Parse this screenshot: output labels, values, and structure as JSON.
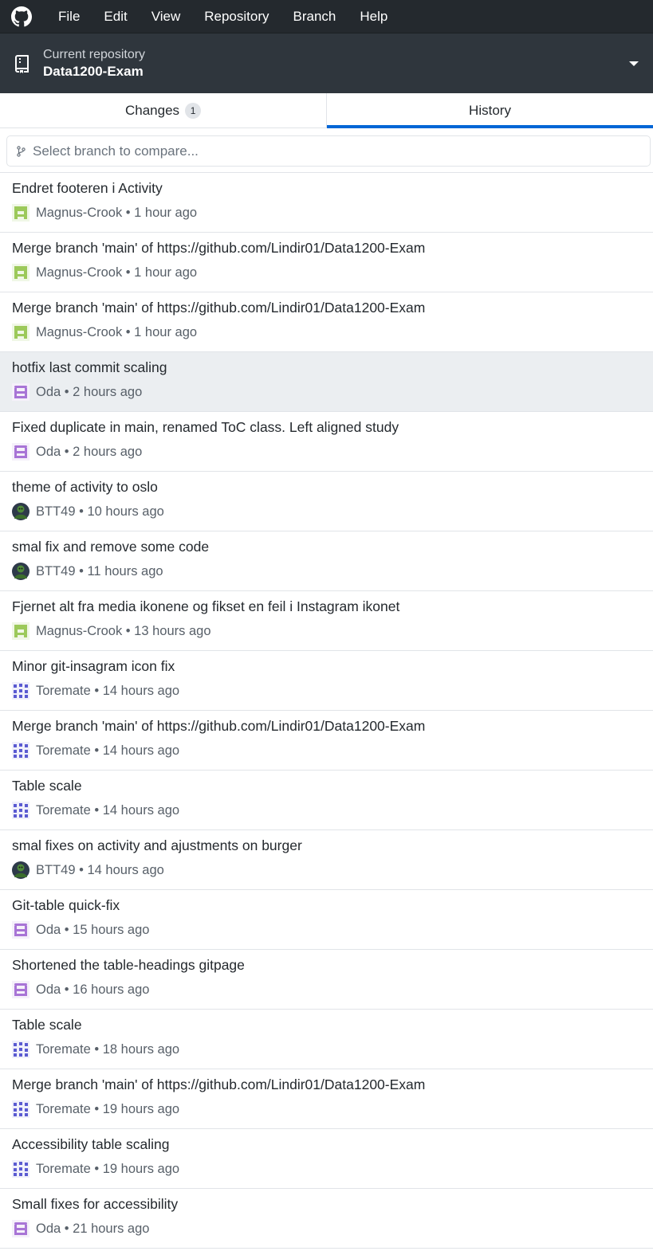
{
  "menu": {
    "items": [
      "File",
      "Edit",
      "View",
      "Repository",
      "Branch",
      "Help"
    ]
  },
  "repository": {
    "label": "Current repository",
    "name": "Data1200-Exam"
  },
  "tabs": {
    "changes_label": "Changes",
    "changes_count": "1",
    "history_label": "History",
    "selected": "History"
  },
  "compare": {
    "placeholder": "Select branch to compare..."
  },
  "colors": {
    "accent": "#0366d6",
    "menubar": "#24292e",
    "repobar": "#2f363d",
    "selected_row": "#ebeef1"
  },
  "commits": [
    {
      "title": "Endret footeren i Activity",
      "author": "Magnus-Crook",
      "time": "1 hour ago",
      "avatar": "green-identicon"
    },
    {
      "title": "Merge branch 'main' of https://github.com/Lindir01/Data1200-Exam",
      "author": "Magnus-Crook",
      "time": "1 hour ago",
      "avatar": "green-identicon"
    },
    {
      "title": "Merge branch 'main' of https://github.com/Lindir01/Data1200-Exam",
      "author": "Magnus-Crook",
      "time": "1 hour ago",
      "avatar": "green-identicon"
    },
    {
      "title": "hotfix last commit scaling",
      "author": "Oda",
      "time": "2 hours ago",
      "avatar": "purple-identicon",
      "selected": true
    },
    {
      "title": "Fixed duplicate in main, renamed ToC class. Left aligned study",
      "author": "Oda",
      "time": "2 hours ago",
      "avatar": "purple-identicon"
    },
    {
      "title": "theme of activity to oslo",
      "author": "BTT49",
      "time": "10 hours ago",
      "avatar": "photo-avatar"
    },
    {
      "title": "smal fix and remove some code",
      "author": "BTT49",
      "time": "11 hours ago",
      "avatar": "photo-avatar"
    },
    {
      "title": "Fjernet alt fra media ikonene og fikset en feil i Instagram ikonet",
      "author": "Magnus-Crook",
      "time": "13 hours ago",
      "avatar": "green-identicon"
    },
    {
      "title": "Minor git-insagram icon fix",
      "author": "Toremate",
      "time": "14 hours ago",
      "avatar": "indigo-identicon"
    },
    {
      "title": "Merge branch 'main' of https://github.com/Lindir01/Data1200-Exam",
      "author": "Toremate",
      "time": "14 hours ago",
      "avatar": "indigo-identicon"
    },
    {
      "title": "Table scale",
      "author": "Toremate",
      "time": "14 hours ago",
      "avatar": "indigo-identicon"
    },
    {
      "title": "smal fixes on activity and ajustments on burger",
      "author": "BTT49",
      "time": "14 hours ago",
      "avatar": "photo-avatar"
    },
    {
      "title": "Git-table quick-fix",
      "author": "Oda",
      "time": "15 hours ago",
      "avatar": "purple-identicon"
    },
    {
      "title": "Shortened the table-headings gitpage",
      "author": "Oda",
      "time": "16 hours ago",
      "avatar": "purple-identicon"
    },
    {
      "title": "Table scale",
      "author": "Toremate",
      "time": "18 hours ago",
      "avatar": "indigo-identicon"
    },
    {
      "title": "Merge branch 'main' of https://github.com/Lindir01/Data1200-Exam",
      "author": "Toremate",
      "time": "19 hours ago",
      "avatar": "indigo-identicon"
    },
    {
      "title": "Accessibility table scaling",
      "author": "Toremate",
      "time": "19 hours ago",
      "avatar": "indigo-identicon"
    },
    {
      "title": "Small fixes for accessibility",
      "author": "Oda",
      "time": "21 hours ago",
      "avatar": "purple-identicon"
    }
  ]
}
